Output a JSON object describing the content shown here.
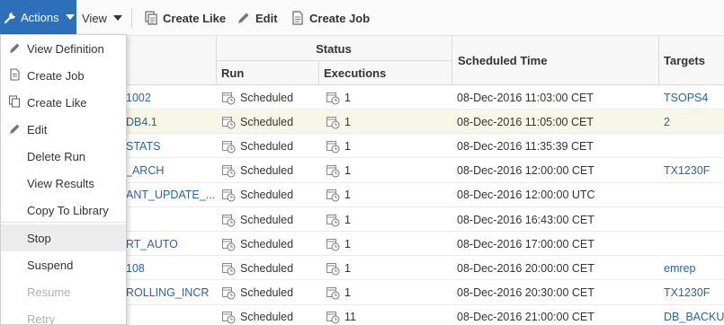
{
  "toolbar": {
    "actions_label": "Actions",
    "view_label": "View",
    "create_like_label": "Create Like",
    "edit_label": "Edit",
    "create_job_label": "Create Job"
  },
  "menu": {
    "items": [
      {
        "label": "View Definition",
        "icon": "pencil-icon",
        "state": "enabled"
      },
      {
        "label": "Create Job",
        "icon": "document-icon",
        "state": "enabled"
      },
      {
        "label": "Create Like",
        "icon": "copy-icon",
        "state": "enabled"
      },
      {
        "label": "Edit",
        "icon": "pencil-icon",
        "state": "enabled"
      },
      {
        "label": "Delete Run",
        "state": "enabled"
      },
      {
        "label": "View Results",
        "state": "enabled"
      },
      {
        "label": "Copy To Library",
        "state": "enabled"
      },
      {
        "label": "Stop",
        "state": "hovered"
      },
      {
        "label": "Suspend",
        "state": "enabled"
      },
      {
        "label": "Resume",
        "state": "disabled"
      },
      {
        "label": "Retry",
        "state": "disabled"
      }
    ]
  },
  "table": {
    "headers": {
      "status_group": "Status",
      "run": "Run",
      "executions": "Executions",
      "scheduled_time": "Scheduled Time",
      "targets": "Targets"
    },
    "rows": [
      {
        "name": "1002",
        "run": "Scheduled",
        "executions": "1",
        "scheduled_time": "08-Dec-2016 11:03:00 CET",
        "targets": "TSOPS4"
      },
      {
        "name": "DB4.1",
        "run": "Scheduled",
        "executions": "1",
        "scheduled_time": "08-Dec-2016 11:05:00 CET",
        "targets": "2"
      },
      {
        "name": "STATS",
        "run": "Scheduled",
        "executions": "1",
        "scheduled_time": "08-Dec-2016 11:35:39 CET",
        "targets": ""
      },
      {
        "name": "_ARCH",
        "run": "Scheduled",
        "executions": "1",
        "scheduled_time": "08-Dec-2016 12:00:00 CET",
        "targets": "TX1230F"
      },
      {
        "name": "ANT_UPDATE_...",
        "run": "Scheduled",
        "executions": "1",
        "scheduled_time": "08-Dec-2016 12:00:00 UTC",
        "targets": ""
      },
      {
        "name": "",
        "run": "Scheduled",
        "executions": "1",
        "scheduled_time": "08-Dec-2016 16:43:00 CET",
        "targets": ""
      },
      {
        "name": "RT_AUTO",
        "run": "Scheduled",
        "executions": "1",
        "scheduled_time": "08-Dec-2016 17:00:00 CET",
        "targets": ""
      },
      {
        "name": "108",
        "run": "Scheduled",
        "executions": "1",
        "scheduled_time": "08-Dec-2016 20:00:00 CET",
        "targets": "emrep"
      },
      {
        "name": "ROLLING_INCR",
        "run": "Scheduled",
        "executions": "1",
        "scheduled_time": "08-Dec-2016 20:30:00 CET",
        "targets": "TX1230F"
      },
      {
        "name": "",
        "run": "Scheduled",
        "executions": "11",
        "scheduled_time": "08-Dec-2016 21:00:00 CET",
        "targets": "DB_BACKU"
      }
    ]
  },
  "colors": {
    "accent": "#2d6fb8",
    "link": "#2a63a6",
    "highlight_row": "#f6f7e6",
    "disabled_text": "#b1b1b1"
  }
}
